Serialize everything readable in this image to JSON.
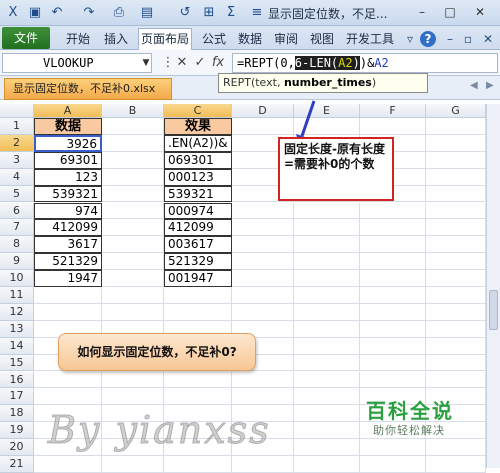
{
  "window": {
    "title": "显示固定位数，不足...",
    "min": "–",
    "restore": "□",
    "close": "✕"
  },
  "quick_access": [
    "save-icon",
    "undo-icon",
    "redo-icon",
    "print-preview-icon",
    "format-painter-icon",
    "table-icon",
    "sum-icon",
    "align-icon"
  ],
  "ribbon": {
    "file_tab": "文件",
    "tabs": [
      "开始",
      "插入",
      "页面布局",
      "公式",
      "数据",
      "审阅",
      "视图",
      "开发工具"
    ],
    "active_tab": "页面布局",
    "help_icon": "?"
  },
  "formula_bar": {
    "name_box": "VLOOKUP",
    "cancel": "✕",
    "enter": "✓",
    "fx": "fx",
    "formula_prefix": "=REPT(0,",
    "formula_selected_pre": "6-LEN(",
    "formula_selected_ref": "A2",
    "formula_selected_post": ")",
    "formula_suffix_pre": ")&",
    "formula_suffix_ref": "A2"
  },
  "doc_tab": {
    "filename": "显示固定位数，不足补0.xlsx"
  },
  "tooltip": {
    "prefix": "REPT(text, ",
    "bold": "number_times",
    "suffix": ")"
  },
  "sheet": {
    "columns": [
      "A",
      "B",
      "C",
      "D",
      "E",
      "F",
      "G"
    ],
    "rows": [
      "1",
      "2",
      "3",
      "4",
      "5",
      "6",
      "7",
      "8",
      "9",
      "10",
      "11",
      "12",
      "13",
      "14",
      "15",
      "16",
      "17",
      "18",
      "19",
      "20",
      "21"
    ],
    "header_a": "数据",
    "header_c": "效果",
    "data_a": [
      "3926",
      "69301",
      "123",
      "539321",
      "974",
      "412099",
      "3617",
      "521329",
      "1947"
    ],
    "data_c": [
      ".EN(A2))&",
      "069301",
      "000123",
      "539321",
      "000974",
      "412099",
      "003617",
      "521329",
      "001947"
    ]
  },
  "annotation": {
    "note": "固定长度-原有长度=需要补0的个数",
    "question": "如何显示固定位数，不足补0?"
  },
  "branding": {
    "site": "百科全说",
    "slogan": "助你轻松解决",
    "watermark": "By yianxss"
  },
  "colors": {
    "file_tab": "#21701e",
    "header_fill": "#f9c9a1",
    "note_border": "#d22222",
    "brand_green": "#2aa040"
  }
}
